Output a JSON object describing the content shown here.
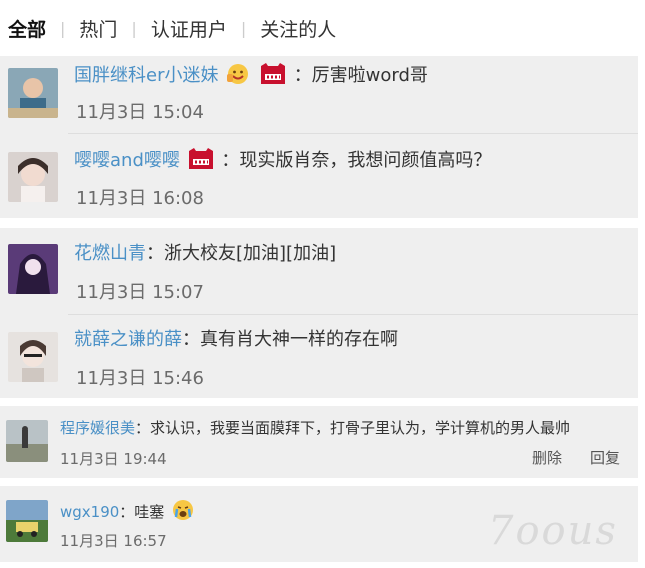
{
  "tabs": [
    "全部",
    "热门",
    "认证用户",
    "关注的人"
  ],
  "comments": [
    {
      "user": "国胖继科er小迷妹",
      "text": "：厉害啦word哥",
      "time": "11月3日 15:04"
    },
    {
      "user": "嘤嘤and嘤嘤",
      "text": "：现实版肖奈，我想问颜值高吗？",
      "time": "11月3日 16:08"
    },
    {
      "user": "花燃山青",
      "text": "：浙大校友[加油][加油]",
      "time": "11月3日 15:07"
    },
    {
      "user": "就薛之谦的薛",
      "text": "：真有肖大神一样的存在啊",
      "time": "11月3日 15:46"
    },
    {
      "user": "程序媛很美",
      "text": "：求认识，我要当面膜拜下，打骨子里认为，学计算机的男人最帅",
      "time": "11月3日 19:44",
      "actions": [
        "删除",
        "回复"
      ]
    },
    {
      "user": "wgx190",
      "text": "：哇塞",
      "time": "11月3日 16:57"
    }
  ],
  "emoji": {
    "tmall": "11.11"
  },
  "watermark": "7oous",
  "colors": {
    "username": "#4a90c6",
    "background": "#efefef",
    "tmall_red": "#c8102e"
  },
  "icons": [
    "avatar",
    "thumbs-up-emoji-icon",
    "tmall-cat-icon",
    "crying-face-icon"
  ]
}
